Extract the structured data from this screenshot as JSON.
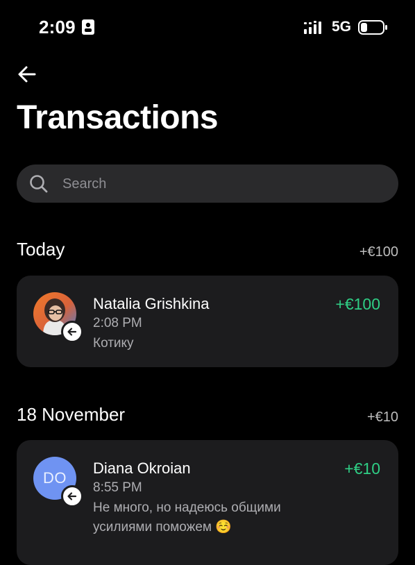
{
  "status_bar": {
    "time": "2:09",
    "network": "5G"
  },
  "header": {
    "title": "Transactions"
  },
  "search": {
    "placeholder": "Search"
  },
  "sections": [
    {
      "label": "Today",
      "total": "+€100",
      "transactions": [
        {
          "name": "Natalia Grishkina",
          "amount": "+€100",
          "time": "2:08 PM",
          "note": "Котику",
          "avatar": "photo",
          "direction_icon": "arrow-left-icon"
        }
      ]
    },
    {
      "label": "18 November",
      "total": "+€10",
      "transactions": [
        {
          "name": "Diana Okroian",
          "amount": "+€10",
          "time": "8:55 PM",
          "note": "Не много, но надеюсь общими усилиями поможем ☺️",
          "avatar_initials": "DO",
          "avatar_color": "#6f93f2",
          "direction_icon": "arrow-left-icon"
        }
      ]
    }
  ],
  "colors": {
    "positive_amount": "#2fce85",
    "card_bg": "#1c1c1e",
    "search_bg": "#2a2a2c"
  }
}
